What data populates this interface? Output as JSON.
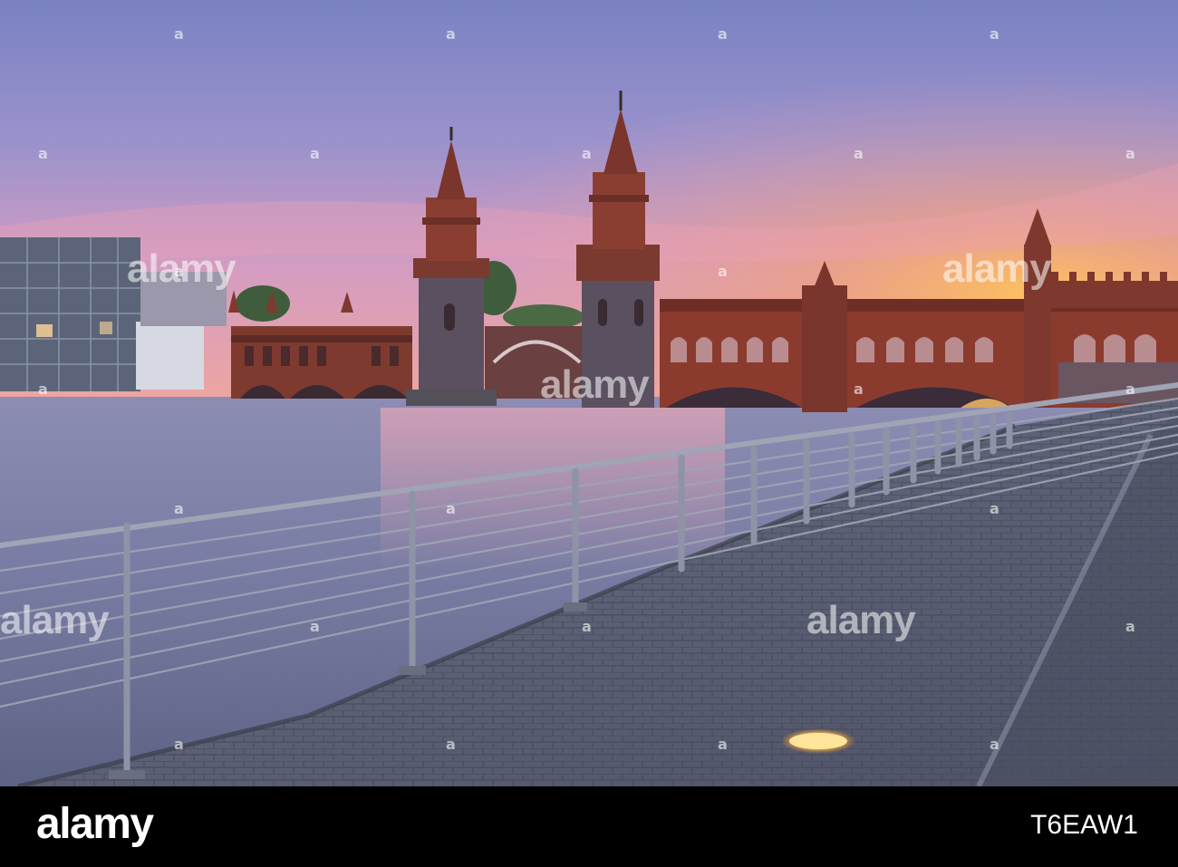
{
  "watermark": {
    "text": "alamy",
    "symbol": "a"
  },
  "footer": {
    "logo": "alamy",
    "image_id": "T6EAW1"
  },
  "colors": {
    "sky_top": "#7d86c6",
    "sky_pink": "#e89ab8",
    "sky_orange": "#f3b15c",
    "brick": "#8a3b2e",
    "water": "#6e7398",
    "cobblestone": "#5a5f72",
    "railing": "#9a9fb0",
    "lamp": "#ffd27a",
    "footer_bg": "#000000"
  }
}
